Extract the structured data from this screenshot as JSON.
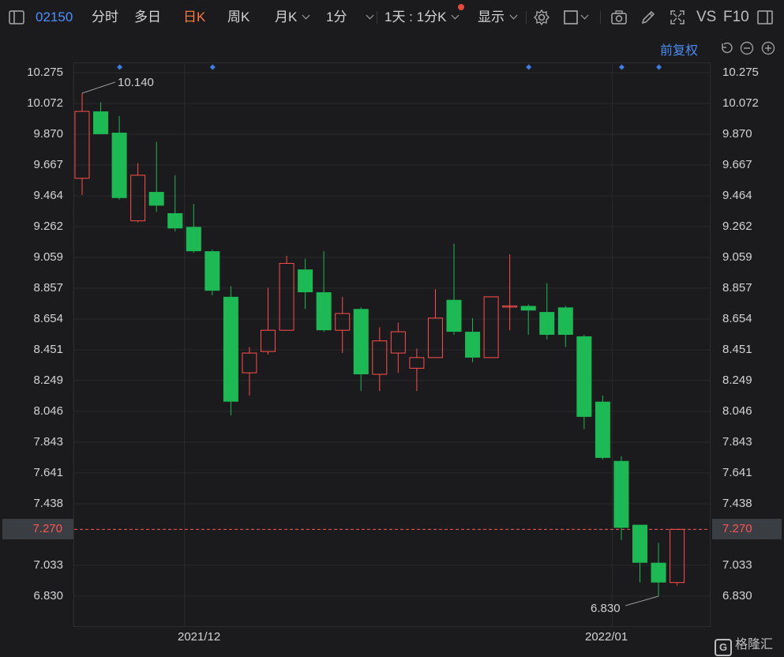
{
  "toolbar": {
    "code": "02150",
    "tabs": [
      {
        "label": "分时"
      },
      {
        "label": "多日"
      },
      {
        "label": "日K",
        "active": true
      },
      {
        "label": "周K"
      },
      {
        "label": "月K"
      },
      {
        "label": "1分"
      }
    ],
    "period": "1天 : 1分K",
    "display": "显示",
    "vs": "VS",
    "f10": "F10",
    "icons": [
      "sidebar-toggle-icon",
      "gear-icon",
      "checkbox-icon",
      "camera-icon",
      "pencil-icon",
      "fullscreen-icon",
      "panel-icon"
    ]
  },
  "adjust": "前复权",
  "colors": {
    "up": "#ff4d4d",
    "down": "#1db954",
    "current": "#ff5555",
    "marker": "#3d7dea"
  },
  "current_price": "7.270",
  "chart_data": {
    "type": "candlestick",
    "y_ticks": [
      "10.275",
      "10.072",
      "9.870",
      "9.667",
      "9.464",
      "9.262",
      "9.059",
      "8.857",
      "8.654",
      "8.451",
      "8.249",
      "8.046",
      "7.843",
      "7.641",
      "7.438",
      "7.033",
      "6.830"
    ],
    "ylim": [
      6.83,
      10.275
    ],
    "x_labels": [
      {
        "label": "2021/12",
        "index": 5
      },
      {
        "label": "2022/01",
        "index": 28
      }
    ],
    "high_label": "10.140",
    "low_label": "6.830",
    "current": 7.27,
    "marker_indices": [
      2,
      7,
      24,
      29,
      31
    ],
    "candles": [
      {
        "o": 9.58,
        "h": 10.14,
        "l": 9.47,
        "c": 10.02
      },
      {
        "o": 10.02,
        "h": 10.08,
        "l": 9.87,
        "c": 9.87
      },
      {
        "o": 9.88,
        "h": 9.99,
        "l": 9.44,
        "c": 9.45
      },
      {
        "o": 9.3,
        "h": 9.68,
        "l": 9.29,
        "c": 9.6
      },
      {
        "o": 9.49,
        "h": 9.82,
        "l": 9.36,
        "c": 9.4
      },
      {
        "o": 9.35,
        "h": 9.6,
        "l": 9.23,
        "c": 9.25
      },
      {
        "o": 9.26,
        "h": 9.41,
        "l": 9.09,
        "c": 9.1
      },
      {
        "o": 9.1,
        "h": 9.11,
        "l": 8.81,
        "c": 8.84
      },
      {
        "o": 8.8,
        "h": 8.87,
        "l": 8.02,
        "c": 8.11
      },
      {
        "o": 8.3,
        "h": 8.47,
        "l": 8.15,
        "c": 8.43
      },
      {
        "o": 8.44,
        "h": 8.86,
        "l": 8.42,
        "c": 8.58
      },
      {
        "o": 8.58,
        "h": 9.07,
        "l": 8.58,
        "c": 9.02
      },
      {
        "o": 8.98,
        "h": 9.05,
        "l": 8.72,
        "c": 8.83
      },
      {
        "o": 8.83,
        "h": 9.1,
        "l": 8.57,
        "c": 8.58
      },
      {
        "o": 8.58,
        "h": 8.8,
        "l": 8.43,
        "c": 8.69
      },
      {
        "o": 8.72,
        "h": 8.73,
        "l": 8.18,
        "c": 8.29
      },
      {
        "o": 8.29,
        "h": 8.6,
        "l": 8.18,
        "c": 8.51
      },
      {
        "o": 8.43,
        "h": 8.63,
        "l": 8.3,
        "c": 8.57
      },
      {
        "o": 8.33,
        "h": 8.46,
        "l": 8.18,
        "c": 8.4
      },
      {
        "o": 8.4,
        "h": 8.85,
        "l": 8.4,
        "c": 8.66
      },
      {
        "o": 8.78,
        "h": 9.15,
        "l": 8.55,
        "c": 8.57
      },
      {
        "o": 8.57,
        "h": 8.66,
        "l": 8.37,
        "c": 8.4
      },
      {
        "o": 8.4,
        "h": 8.8,
        "l": 8.4,
        "c": 8.8
      },
      {
        "o": 8.74,
        "h": 9.08,
        "l": 8.58,
        "c": 8.74
      },
      {
        "o": 8.74,
        "h": 8.75,
        "l": 8.55,
        "c": 8.71
      },
      {
        "o": 8.7,
        "h": 8.89,
        "l": 8.52,
        "c": 8.55
      },
      {
        "o": 8.73,
        "h": 8.74,
        "l": 8.47,
        "c": 8.55
      },
      {
        "o": 8.54,
        "h": 8.55,
        "l": 7.93,
        "c": 8.01
      },
      {
        "o": 8.11,
        "h": 8.15,
        "l": 7.73,
        "c": 7.74
      },
      {
        "o": 7.72,
        "h": 7.75,
        "l": 7.2,
        "c": 7.28
      },
      {
        "o": 7.3,
        "h": 7.3,
        "l": 6.92,
        "c": 7.05
      },
      {
        "o": 7.05,
        "h": 7.18,
        "l": 6.83,
        "c": 6.92
      },
      {
        "o": 6.92,
        "h": 7.27,
        "l": 6.9,
        "c": 7.27
      }
    ]
  }
}
